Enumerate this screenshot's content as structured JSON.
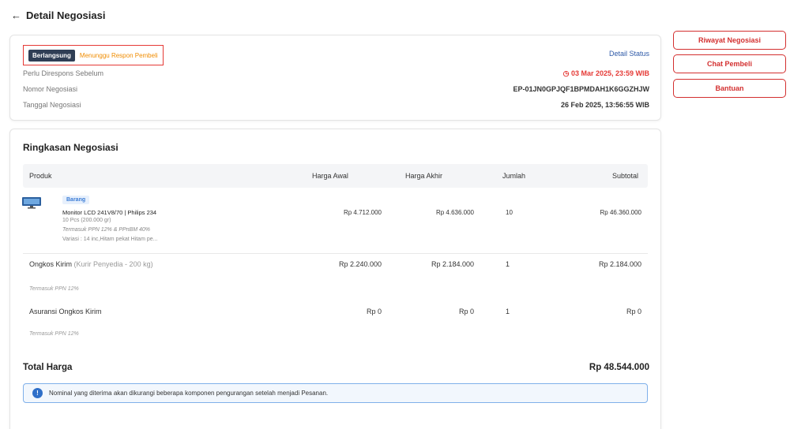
{
  "header": {
    "back_icon": "arrow-left-icon",
    "title": "Detail Negosiasi"
  },
  "status": {
    "badge": "Berlangsung",
    "state": "Menunggu Respon Pembeli",
    "detail_link": "Detail Status",
    "rows": [
      {
        "label": "Perlu Direspons Sebelum",
        "value": "03 Mar 2025, 23:59 WIB",
        "color": "#e53935",
        "icon": "clock-icon"
      },
      {
        "label": "Nomor Negosiasi",
        "value": "EP-01JN0GPJQF1BPMDAH1K6GGZHJW"
      },
      {
        "label": "Tanggal Negosiasi",
        "value": "26 Feb 2025, 13:56:55 WIB"
      }
    ]
  },
  "side_buttons": [
    "Riwayat Negosiasi",
    "Chat Pembeli",
    "Bantuan"
  ],
  "summary": {
    "title": "Ringkasan Negosiasi",
    "columns": [
      "Produk",
      "Harga Awal",
      "Harga Akhir",
      "Jumlah",
      "Subtotal"
    ],
    "product": {
      "tag": "Barang",
      "name": "Monitor LCD 241V8/70 | Philips 234",
      "qty_weight": "10 Pcs (200.000 gr)",
      "tax_note": "Termasuk PPN 12% & PPnBM 40%",
      "variant": "Variasi   : 14 inc,Hitam pekat Hitam pe...",
      "harga_awal": "Rp 4.712.000",
      "harga_akhir": "Rp 4.636.000",
      "jumlah": "10",
      "subtotal": "Rp 46.360.000"
    },
    "shipping": {
      "label": "Ongkos Kirim",
      "courier": "(Kurir Penyedia - 200 kg)",
      "harga_awal": "Rp 2.240.000",
      "harga_akhir": "Rp 2.184.000",
      "jumlah": "1",
      "subtotal": "Rp 2.184.000",
      "note": "Termasuk PPN 12%"
    },
    "insurance": {
      "label": "Asuransi Ongkos Kirim",
      "harga_awal": "Rp 0",
      "harga_akhir": "Rp 0",
      "jumlah": "1",
      "subtotal": "Rp 0",
      "note": "Termasuk PPN 12%"
    },
    "total_label": "Total Harga",
    "total_value": "Rp 48.544.000",
    "info_icon": "info-icon",
    "info_text": "Nominal yang diterima akan dikurangi beberapa komponen pengurangan setelah menjadi Pesanan."
  },
  "colors": {
    "accent": "#d32f2f",
    "badge_dark": "#2f3e55",
    "pending": "#f08c00",
    "link": "#2f5aa8",
    "info": "#2f6fc8"
  }
}
